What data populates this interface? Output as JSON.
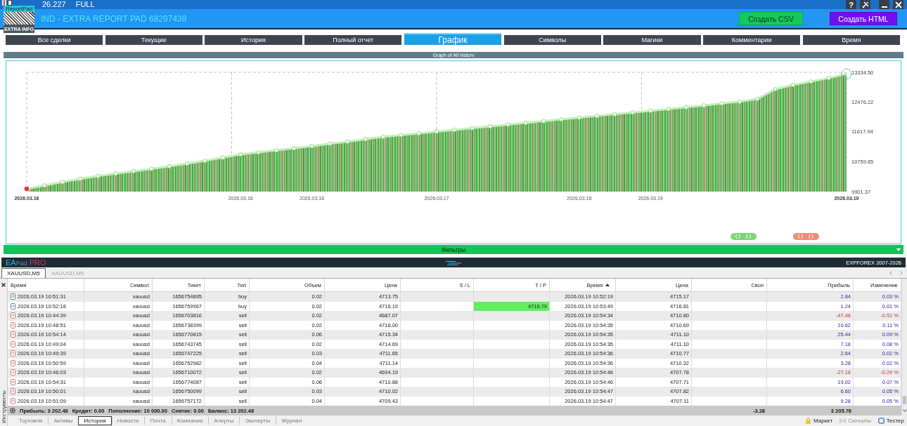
{
  "top_bar": {
    "version": "26.227",
    "edition": "FULL",
    "help": "?"
  },
  "logo": {
    "top_label": "ReportPad",
    "bottom_label": "EXTRA INFO"
  },
  "header": {
    "title": "IND - EXTRA REPORT PAD 68297438",
    "buttons": [
      {
        "label": "Создать CSV",
        "kind": "csv"
      },
      {
        "label": "Создать HTML",
        "kind": "html"
      }
    ]
  },
  "tabs": [
    {
      "label": "Все сделки",
      "selected": false
    },
    {
      "label": "Текущие",
      "selected": false
    },
    {
      "label": "История",
      "selected": false
    },
    {
      "label": "Полный отчет",
      "selected": false
    },
    {
      "label": "График",
      "selected": true
    },
    {
      "label": "Символы",
      "selected": false
    },
    {
      "label": "Магики",
      "selected": false
    },
    {
      "label": "Комментарии",
      "selected": false
    },
    {
      "label": "Время",
      "selected": false
    }
  ],
  "chart_data": {
    "type": "area",
    "title": "Graph of All historv",
    "categories": [
      "2026.03.16",
      null,
      null,
      null,
      null,
      null,
      null,
      null,
      null,
      null,
      null,
      null,
      "2026.03.16",
      null,
      null,
      null,
      "2026.03.16",
      null,
      null,
      null,
      null,
      null,
      null,
      "2026.03.17",
      null,
      null,
      null,
      null,
      null,
      null,
      null,
      "2026.03.18",
      null,
      null,
      null,
      "2026.03.19",
      null,
      null,
      null,
      null,
      null,
      null,
      null,
      null,
      null,
      null,
      "2026.03.19"
    ],
    "values": [
      9980,
      10080,
      10180,
      10270,
      10350,
      10420,
      10490,
      10560,
      10630,
      10710,
      10790,
      10880,
      10970,
      11030,
      11090,
      11150,
      11210,
      11280,
      11340,
      11410,
      11480,
      11530,
      11580,
      11630,
      11680,
      11730,
      11780,
      11830,
      11880,
      11930,
      11980,
      12030,
      12080,
      12130,
      12180,
      12230,
      12280,
      12330,
      12380,
      12440,
      12490,
      12570,
      12850,
      12970,
      13070,
      13170,
      13290
    ],
    "ylim": [
      9901.37,
      13334.5
    ],
    "yticks": [
      {
        "value": 13334.5,
        "label": "13334.50"
      },
      {
        "value": 12476.22,
        "label": "12476.22"
      },
      {
        "value": 11617.94,
        "label": "11617.94"
      },
      {
        "value": 10759.65,
        "label": "10759.65"
      },
      {
        "value": 9901.37,
        "label": "9901.37"
      }
    ]
  },
  "filters": {
    "label": "Фильтры"
  },
  "footer": {
    "brand_parts": [
      "EA",
      "Pad"
    ],
    "edition": "PRO",
    "copyright": "EXPFOREX 2007-2026"
  },
  "chart_tabs": [
    {
      "label": "XAUUSD,M5",
      "selected": true
    },
    {
      "label": "XAUUSD,M5",
      "selected": false
    }
  ],
  "history_table": {
    "columns": [
      {
        "label": "Время",
        "sorted": false
      },
      {
        "label": "Символ",
        "sorted": false
      },
      {
        "label": "Тикет",
        "sorted": false
      },
      {
        "label": "Тип",
        "sorted": false
      },
      {
        "label": "Объем",
        "sorted": false
      },
      {
        "label": "Цена",
        "sorted": false
      },
      {
        "label": "S / L",
        "sorted": false
      },
      {
        "label": "T / P",
        "sorted": false
      },
      {
        "label": "Время",
        "sorted": true
      },
      {
        "label": "Цена",
        "sorted": false
      },
      {
        "label": "Своп",
        "sorted": false
      },
      {
        "label": "Прибыль",
        "sorted": false
      },
      {
        "label": "Изменение",
        "sorted": false
      }
    ],
    "rows": [
      {
        "kind": "buy",
        "time": "2026.03.19 10:51:31",
        "symbol": "xauusd",
        "ticket": "1656754895",
        "type": "buy",
        "volume": "0.02",
        "open_price": "4713.75",
        "close_time": "2026.03.19 10:52:19",
        "close_price": "4715.17",
        "profit": "2.84",
        "change": "0.03 %",
        "loss": false
      },
      {
        "kind": "buy",
        "time": "2026.03.19 10:52:18",
        "symbol": "xauusd",
        "ticket": "1656759967",
        "type": "buy",
        "volume": "0.02",
        "open_price": "4716.19",
        "tp": {
          "text": "4716.79",
          "hit": true
        },
        "close_time": "2026.03.19 10:53:49",
        "close_price": "4716.81",
        "profit": "1.24",
        "change": "0.01 %",
        "loss": false
      },
      {
        "kind": "sell",
        "time": "2026.03.19 10:44:39",
        "symbol": "xauusd",
        "ticket": "1656703816",
        "type": "sell",
        "volume": "0.02",
        "open_price": "4687.07",
        "close_time": "2026.03.19 10:54:34",
        "close_price": "4710.80",
        "profit": "-47.46",
        "change": "-0.51 %",
        "loss": true
      },
      {
        "kind": "sell",
        "time": "2026.03.19 10:48:51",
        "symbol": "xauusd",
        "ticket": "1656738399",
        "type": "sell",
        "volume": "0.02",
        "open_price": "4716.00",
        "close_time": "2026.03.19 10:54:35",
        "close_price": "4710.69",
        "profit": "10.62",
        "change": "0.11 %",
        "loss": false
      },
      {
        "kind": "sell",
        "time": "2026.03.19 10:54:14",
        "symbol": "xauusd",
        "ticket": "1656770815",
        "type": "sell",
        "volume": "0.06",
        "open_price": "4715.34",
        "close_time": "2026.03.19 10:54:35",
        "close_price": "4711.10",
        "profit": "25.44",
        "change": "0.09 %",
        "loss": false
      },
      {
        "kind": "sell",
        "time": "2026.03.19 10:49:04",
        "symbol": "xauusd",
        "ticket": "1656743745",
        "type": "sell",
        "volume": "0.02",
        "open_price": "4714.69",
        "close_time": "2026.03.19 10:54:35",
        "close_price": "4711.10",
        "profit": "7.18",
        "change": "0.08 %",
        "loss": false
      },
      {
        "kind": "sell",
        "time": "2026.03.19 10:49:39",
        "symbol": "xauusd",
        "ticket": "1656747225",
        "type": "sell",
        "volume": "0.03",
        "open_price": "4711.65",
        "close_time": "2026.03.19 10:54:36",
        "close_price": "4710.77",
        "profit": "2.64",
        "change": "0.02 %",
        "loss": false
      },
      {
        "kind": "sell",
        "time": "2026.03.19 10:50:59",
        "symbol": "xauusd",
        "ticket": "1656752982",
        "type": "sell",
        "volume": "0.04",
        "open_price": "4711.14",
        "close_time": "2026.03.19 10:54:36",
        "close_price": "4710.32",
        "profit": "3.28",
        "change": "0.02 %",
        "loss": false
      },
      {
        "kind": "sell",
        "time": "2026.03.19 10:46:03",
        "symbol": "xauusd",
        "ticket": "1656710072",
        "type": "sell",
        "volume": "0.02",
        "open_price": "4694.19",
        "close_time": "2026.03.19 10:54:46",
        "close_price": "4707.78",
        "profit": "-27.18",
        "change": "-0.29 %",
        "loss": true
      },
      {
        "kind": "sell",
        "time": "2026.03.19 10:54:31",
        "symbol": "xauusd",
        "ticket": "1656774087",
        "type": "sell",
        "volume": "0.06",
        "open_price": "4710.88",
        "close_time": "2026.03.19 10:54:46",
        "close_price": "4707.71",
        "profit": "19.02",
        "change": "0.07 %",
        "loss": false
      },
      {
        "kind": "sell",
        "time": "2026.03.19 10:50:01",
        "symbol": "xauusd",
        "ticket": "1656750099",
        "type": "sell",
        "volume": "0.03",
        "open_price": "4710.02",
        "close_time": "2026.03.19 10:54:47",
        "close_price": "4707.82",
        "profit": "6.60",
        "change": "0.05 %",
        "loss": false
      },
      {
        "kind": "sell",
        "time": "2026.03.19 10:51:09",
        "symbol": "xauusd",
        "ticket": "1656757172",
        "type": "sell",
        "volume": "0.04",
        "open_price": "4709.43",
        "close_time": "2026.03.19 10:54:47",
        "close_price": "4707.11",
        "profit": "9.28",
        "change": "0.05 %",
        "loss": false
      }
    ],
    "summary": {
      "items": [
        "Прибыль: 3 202.48",
        "Кредит: 0.00",
        "Пополнение: 10 000.00",
        "Снятие: 0.00",
        "Баланс: 13 202.48"
      ],
      "swap": "-3.28",
      "profit": "3 205.76"
    }
  },
  "side_panel": {
    "label": "Инструменты"
  },
  "bottom_tabs": [
    {
      "label": "Торговля",
      "selected": false
    },
    {
      "label": "Активы",
      "selected": false
    },
    {
      "label": "История",
      "selected": true
    },
    {
      "label": "Новости",
      "selected": false
    },
    {
      "label": "Почта",
      "selected": false
    },
    {
      "label": "Компания",
      "selected": false
    },
    {
      "label": "Алерты",
      "selected": false
    },
    {
      "label": "Эксперты",
      "selected": false
    },
    {
      "label": "Журнал",
      "selected": false
    }
  ],
  "status_items": [
    {
      "label": "Маркет",
      "kind": "market",
      "disabled": false
    },
    {
      "label": "Сигналы",
      "kind": "signals",
      "disabled": true
    },
    {
      "label": "Тестер",
      "kind": "tester",
      "disabled": false
    }
  ]
}
